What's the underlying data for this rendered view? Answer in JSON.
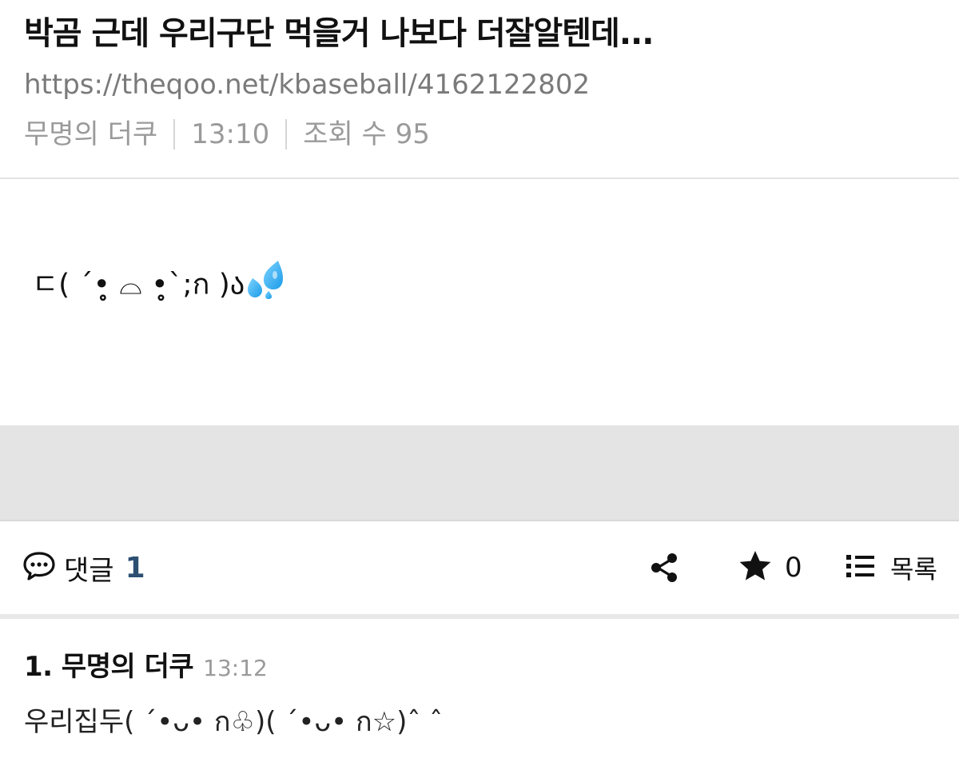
{
  "post": {
    "title": "박곰 근데 우리구단 먹을거 나보다 더잘알텐데...",
    "url": "https://theqoo.net/kbaseball/4162122802",
    "author": "무명의 더쿠",
    "time": "13:10",
    "views": "조회 수 95",
    "body": "ㄷ( ˊ•̥̥̥̥̥ ⌓ •̥̥̥̥̥ˋ;ก )ა"
  },
  "colors": {
    "accent": "#2c4f72",
    "meta_text": "#9a9a9a",
    "url_text": "#7a7a7a",
    "band": "#e4e4e4"
  },
  "actions": {
    "comment_label": "댓글",
    "comment_count": "1",
    "star_count": "0",
    "list_label": "목록"
  },
  "icons": {
    "comment": "speech-bubble-icon",
    "share": "share-icon",
    "star": "star-icon",
    "list": "list-icon",
    "sweat": "sweat-droplets-emoji"
  },
  "comments": [
    {
      "number_author": "1. 무명의 더쿠",
      "time": "13:12",
      "text": "우리집두( ˊ•ᴗ• ก♧)( ˊ•ᴗ• ก☆)ˆ ˆ"
    }
  ]
}
